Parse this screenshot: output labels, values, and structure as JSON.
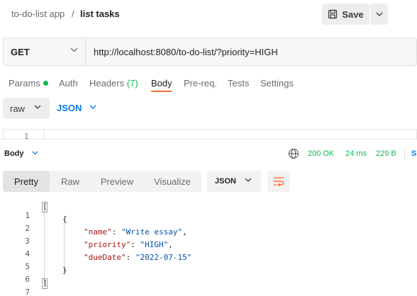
{
  "header": {
    "collection": "to-do-list app",
    "separator": "/",
    "request_name": "list tasks",
    "save_label": "Save"
  },
  "request": {
    "method": "GET",
    "url": "http://localhost:8080/to-do-list/?priority=HIGH"
  },
  "tabs": [
    {
      "label": "Params"
    },
    {
      "label": "Auth"
    },
    {
      "label": "Headers",
      "count": "(7)"
    },
    {
      "label": "Body"
    },
    {
      "label": "Pre-req."
    },
    {
      "label": "Tests"
    },
    {
      "label": "Settings"
    }
  ],
  "active_tab": "Body",
  "body_editor": {
    "type": "raw",
    "format": "JSON",
    "line_number": "1"
  },
  "response": {
    "label": "Body",
    "status": "200 OK",
    "time": "24 ms",
    "size": "229 B",
    "save_label": "S",
    "view_tabs": [
      "Pretty",
      "Raw",
      "Preview",
      "Visualize"
    ],
    "active_view": "Pretty",
    "format": "JSON",
    "lines": [
      {
        "n": "1",
        "text": "["
      },
      {
        "n": "2",
        "text": "{"
      },
      {
        "n": "3",
        "key": "\"name\"",
        "value": "\"Write essay\""
      },
      {
        "n": "4",
        "key": "\"priority\"",
        "value": "\"HIGH\""
      },
      {
        "n": "5",
        "key": "\"dueDate\"",
        "value": "\"2022-07-15\""
      },
      {
        "n": "6",
        "text": "}"
      },
      {
        "n": "7",
        "text": "]"
      }
    ]
  },
  "colors": {
    "accent_orange": "#ff6c37",
    "success_green": "#0cbb52",
    "link_blue": "#097bed",
    "json_key": "#a31515",
    "json_string": "#0451a5"
  },
  "icons": [
    "save-icon",
    "chevron-down-icon",
    "globe-icon",
    "wrap-lines-icon"
  ]
}
